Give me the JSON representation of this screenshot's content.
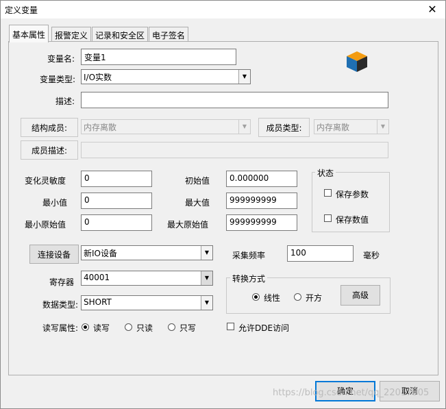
{
  "window": {
    "title": "定义变量",
    "close_glyph": "✕"
  },
  "tabs": [
    {
      "label": "基本属性",
      "active": true
    },
    {
      "label": "报警定义",
      "active": false
    },
    {
      "label": "记录和安全区",
      "active": false
    },
    {
      "label": "电子签名",
      "active": false
    }
  ],
  "basic": {
    "var_name_label": "变量名:",
    "var_name_value": "变量1",
    "var_type_label": "变量类型:",
    "var_type_value": "I/O实数",
    "desc_label": "描述:",
    "desc_value": "",
    "struct_member_label": "结构成员:",
    "struct_member_value": "内存离散",
    "member_type_label": "成员类型:",
    "member_type_value": "内存离散",
    "member_desc_label": "成员描述:",
    "member_desc_value": ""
  },
  "values": {
    "sensitivity_label": "变化灵敏度",
    "sensitivity_value": "0",
    "initial_label": "初始值",
    "initial_value": "0.000000",
    "min_label": "最小值",
    "min_value": "0",
    "max_label": "最大值",
    "max_value": "999999999",
    "min_raw_label": "最小原始值",
    "min_raw_value": "0",
    "max_raw_label": "最大原始值",
    "max_raw_value": "999999999"
  },
  "status_group": {
    "title": "状态",
    "save_params_label": "保存参数",
    "save_params_checked": false,
    "save_value_label": "保存数值",
    "save_value_checked": false
  },
  "device": {
    "connect_button": "连接设备",
    "device_value": "新IO设备",
    "sample_label": "采集频率",
    "sample_value": "100",
    "sample_unit": "毫秒",
    "register_label": "寄存器",
    "register_value": "40001",
    "datatype_label": "数据类型:",
    "datatype_value": "SHORT"
  },
  "access": {
    "label": "读写属性:",
    "options": [
      {
        "label": "读写",
        "selected": true
      },
      {
        "label": "只读",
        "selected": false
      },
      {
        "label": "只写",
        "selected": false
      }
    ],
    "dde_label": "允许DDE访问",
    "dde_checked": false
  },
  "conversion": {
    "title": "转换方式",
    "linear_label": "线性",
    "linear_selected": true,
    "sqrt_label": "开方",
    "sqrt_selected": false,
    "advanced_button": "高级"
  },
  "footer": {
    "ok_button": "确定",
    "cancel_button": "取消"
  },
  "watermark": "https://blog.csdn.net/qq_22017005",
  "icon": {
    "name": "cube-icon",
    "colors": [
      "#f39c12",
      "#1f6fb2",
      "#2a2a2a"
    ]
  }
}
